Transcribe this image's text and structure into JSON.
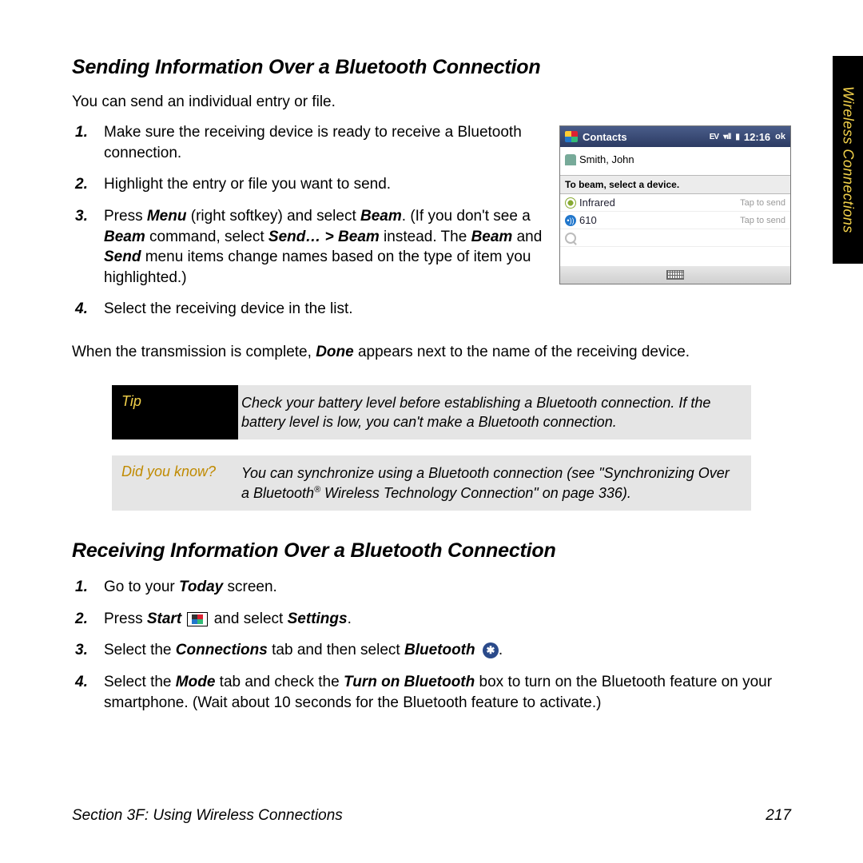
{
  "sideTab": "Wireless Connections",
  "section1": {
    "heading": "Sending Information Over a Bluetooth Connection",
    "intro": "You can send an individual entry or file.",
    "step1": "Make sure the receiving device is ready to receive a Bluetooth connection.",
    "step2": "Highlight the entry or file you want to send.",
    "step3_a": "Press ",
    "step3_menu": "Menu",
    "step3_b": " (right softkey) and select ",
    "step3_beam": "Beam",
    "step3_c": ". (If you don't see a ",
    "step3_beam2": "Beam",
    "step3_d": " command, select ",
    "step3_send": "Send… > Beam",
    "step3_e": " instead. The ",
    "step3_beam3": "Beam",
    "step3_f": " and ",
    "step3_send2": "Send",
    "step3_g": " menu items change names based on the type of item you highlighted.)",
    "step4": "Select the receiving device in the list.",
    "after_a": "When the transmission is complete, ",
    "after_done": "Done",
    "after_b": " appears next to the name of the receiving device."
  },
  "shot": {
    "title": "Contacts",
    "ev": "EV",
    "time": "12:16",
    "ok": "ok",
    "contact": "Smith, John",
    "label": "To beam, select a device.",
    "row1_name": "Infrared",
    "row1_status": "Tap to send",
    "row2_name": "610",
    "row2_status": "Tap to send"
  },
  "tip": {
    "label": "Tip",
    "text": "Check your battery level before establishing a Bluetooth connection. If the battery level is low, you can't make a Bluetooth connection."
  },
  "dyk": {
    "label": "Did you know?",
    "text_a": "You can synchronize using a Bluetooth connection (see \"Synchronizing Over a Bluetooth",
    "text_b": " Wireless Technology Connection\" on page 336)."
  },
  "section2": {
    "heading": "Receiving Information Over a Bluetooth Connection",
    "s1_a": "Go to your ",
    "s1_today": "Today",
    "s1_b": " screen.",
    "s2_a": "Press ",
    "s2_start": "Start",
    "s2_b": " and select ",
    "s2_settings": "Settings",
    "s2_c": ".",
    "s3_a": "Select the ",
    "s3_conn": "Connections",
    "s3_b": " tab and then select ",
    "s3_bt": "Bluetooth",
    "s3_c": ".",
    "s4_a": "Select the ",
    "s4_mode": "Mode",
    "s4_b": " tab and check the ",
    "s4_turn": "Turn on Bluetooth",
    "s4_c": " box to turn on the Bluetooth feature on your smartphone. (Wait about 10 seconds for the Bluetooth feature to activate.)"
  },
  "footer": {
    "left": "Section 3F: Using Wireless Connections",
    "right": "217"
  }
}
